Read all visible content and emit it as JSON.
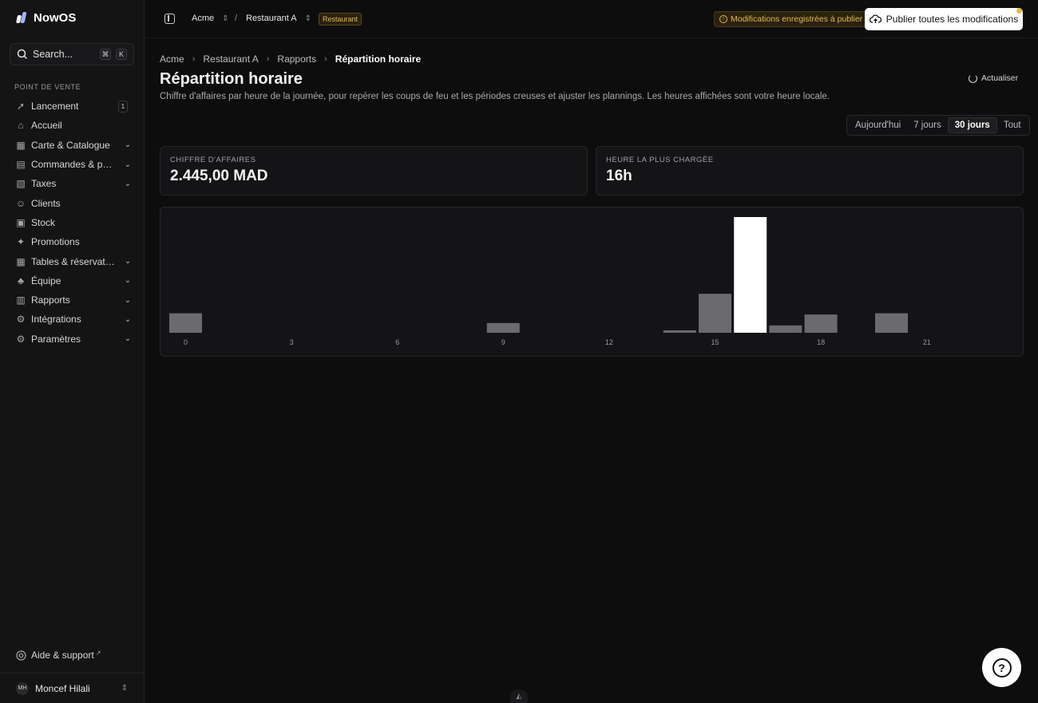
{
  "app": {
    "name": "NowOS"
  },
  "search": {
    "placeholder": "Search...",
    "shortcut_1": "⌘",
    "shortcut_2": "K"
  },
  "sidebar": {
    "section": "POINT DE VENTE",
    "items": [
      {
        "label": "Lancement",
        "icon": "rocket-icon",
        "badge": "1",
        "chevron": false
      },
      {
        "label": "Accueil",
        "icon": "home-icon",
        "chevron": false
      },
      {
        "label": "Carte & Catalogue",
        "icon": "grid-icon",
        "chevron": true
      },
      {
        "label": "Commandes & paiements",
        "icon": "receipt-icon",
        "chevron": true
      },
      {
        "label": "Taxes",
        "icon": "tax-icon",
        "chevron": true
      },
      {
        "label": "Clients",
        "icon": "users-icon",
        "chevron": false
      },
      {
        "label": "Stock",
        "icon": "box-icon",
        "chevron": false
      },
      {
        "label": "Promotions",
        "icon": "gift-icon",
        "chevron": false
      },
      {
        "label": "Tables & réservations",
        "icon": "table-icon",
        "chevron": true
      },
      {
        "label": "Équipe",
        "icon": "team-icon",
        "chevron": true
      },
      {
        "label": "Rapports",
        "icon": "chart-icon",
        "chevron": true
      },
      {
        "label": "Intégrations",
        "icon": "plug-icon",
        "chevron": true
      },
      {
        "label": "Paramètres",
        "icon": "gear-icon",
        "chevron": true
      }
    ],
    "help": "Aide & support",
    "user": {
      "initials": "MH",
      "name": "Moncef Hilali"
    }
  },
  "topbar": {
    "org": "Acme",
    "separator": "/",
    "location": "Restaurant A",
    "type_badge": "Restaurant",
    "pending": "Modifications enregistrées à publier",
    "publish": "Publier toutes les modifications"
  },
  "breadcrumb": [
    "Acme",
    "Restaurant A",
    "Rapports",
    "Répartition horaire"
  ],
  "page": {
    "title": "Répartition horaire",
    "subtitle": "Chiffre d'affaires par heure de la journée, pour repérer les coups de feu et les périodes creuses et ajuster les plannings. Les heures affichées sont votre heure locale.",
    "refresh": "Actualiser"
  },
  "range": {
    "options": [
      "Aujourd'hui",
      "7 jours",
      "30 jours",
      "Tout"
    ],
    "selected": "30 jours"
  },
  "kpis": [
    {
      "label": "CHIFFRE D'AFFAIRES",
      "value": "2.445,00 MAD"
    },
    {
      "label": "HEURE LA PLUS CHARGÉE",
      "value": "16h"
    }
  ],
  "colors": {
    "accent": "#e6b948",
    "bar": "#6b6b6e",
    "bar_peak": "#ffffff"
  },
  "chart_data": {
    "type": "bar",
    "categories": [
      "0",
      "1",
      "2",
      "3",
      "4",
      "5",
      "6",
      "7",
      "8",
      "9",
      "10",
      "11",
      "12",
      "13",
      "14",
      "15",
      "16",
      "17",
      "18",
      "19",
      "20",
      "21",
      "22",
      "23"
    ],
    "tick_labels": [
      "0",
      "3",
      "6",
      "9",
      "12",
      "15",
      "18",
      "21"
    ],
    "values": [
      160,
      0,
      0,
      0,
      0,
      0,
      0,
      0,
      0,
      80,
      0,
      0,
      0,
      0,
      20,
      320,
      950,
      60,
      150,
      0,
      160,
      0,
      0,
      0
    ],
    "highlight_index": 16
  }
}
